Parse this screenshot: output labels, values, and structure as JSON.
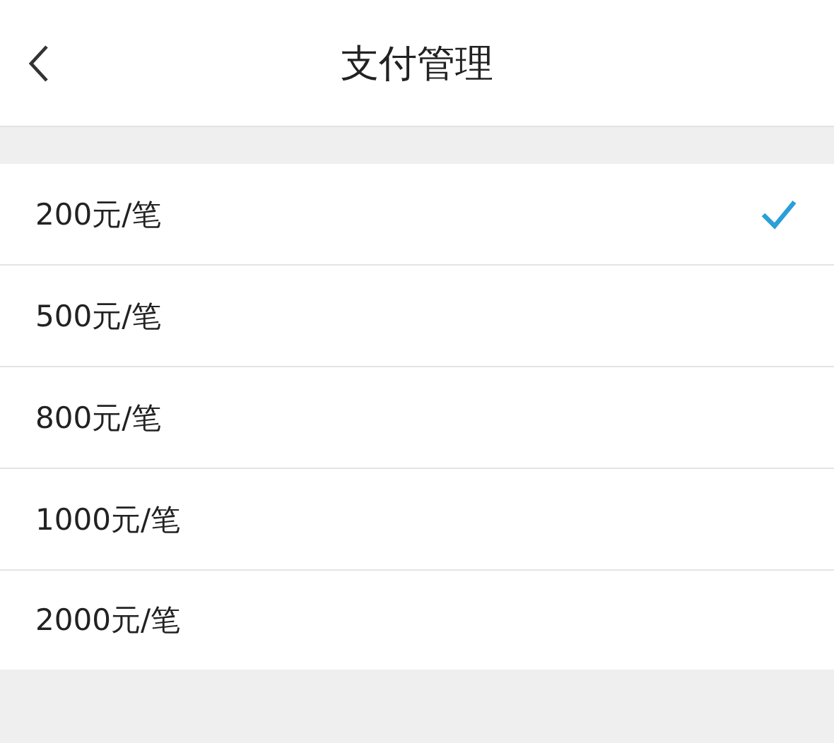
{
  "header": {
    "title": "支付管理"
  },
  "options": [
    {
      "label": "200元/笔",
      "selected": true
    },
    {
      "label": "500元/笔",
      "selected": false
    },
    {
      "label": "800元/笔",
      "selected": false
    },
    {
      "label": "1000元/笔",
      "selected": false
    },
    {
      "label": "2000元/笔",
      "selected": false
    }
  ]
}
